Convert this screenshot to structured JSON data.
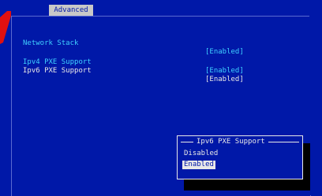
{
  "header": {
    "tab_label": "Advanced"
  },
  "settings": [
    {
      "label": "Network Stack",
      "value": "[Enabled]"
    },
    {
      "label": "Ipv4 PXE Support",
      "value": "[Enabled]"
    },
    {
      "label": "Ipv6 PXE Support",
      "value": "[Enabled]"
    }
  ],
  "popup": {
    "title": "Ipv6 PXE Support",
    "options": [
      "Disabled",
      "Enabled"
    ],
    "selected": "Enabled"
  },
  "colors": {
    "background": "#0018a8",
    "option_text": "#3fd0ff",
    "highlight_text": "#e8e8e8",
    "selection_bg": "#e8e8e8",
    "warning_shape": "#e01010"
  }
}
